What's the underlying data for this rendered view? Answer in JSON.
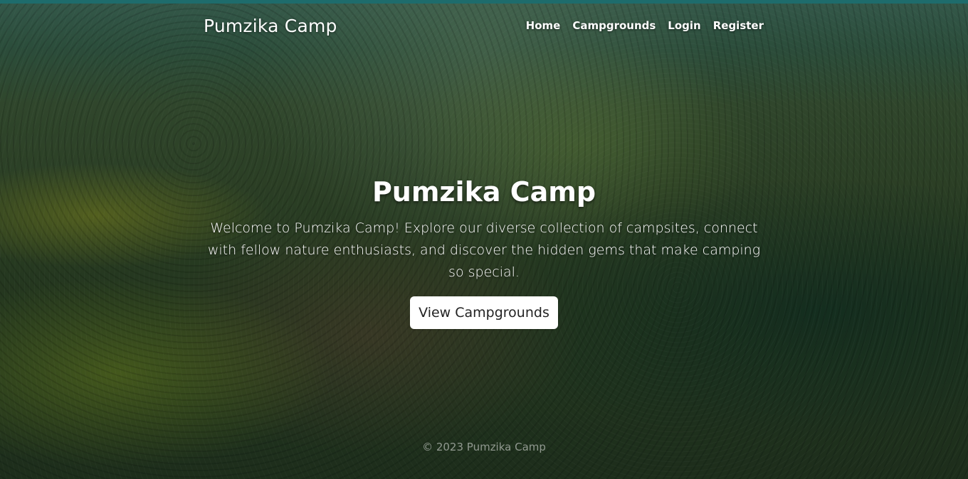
{
  "header": {
    "brand": "Pumzika Camp",
    "nav": [
      "Home",
      "Campgrounds",
      "Login",
      "Register"
    ]
  },
  "hero": {
    "title": "Pumzika Camp",
    "description": "Welcome to Pumzika Camp! Explore our diverse collection of campsites, connect with fellow nature enthusiasts, and discover the hidden gems that make camping so special.",
    "cta_label": "View Campgrounds"
  },
  "footer": {
    "copyright": "© 2023 Pumzika Camp"
  },
  "colors": {
    "accent_topline": "#1e6c6c",
    "button_bg": "#ffffff"
  }
}
